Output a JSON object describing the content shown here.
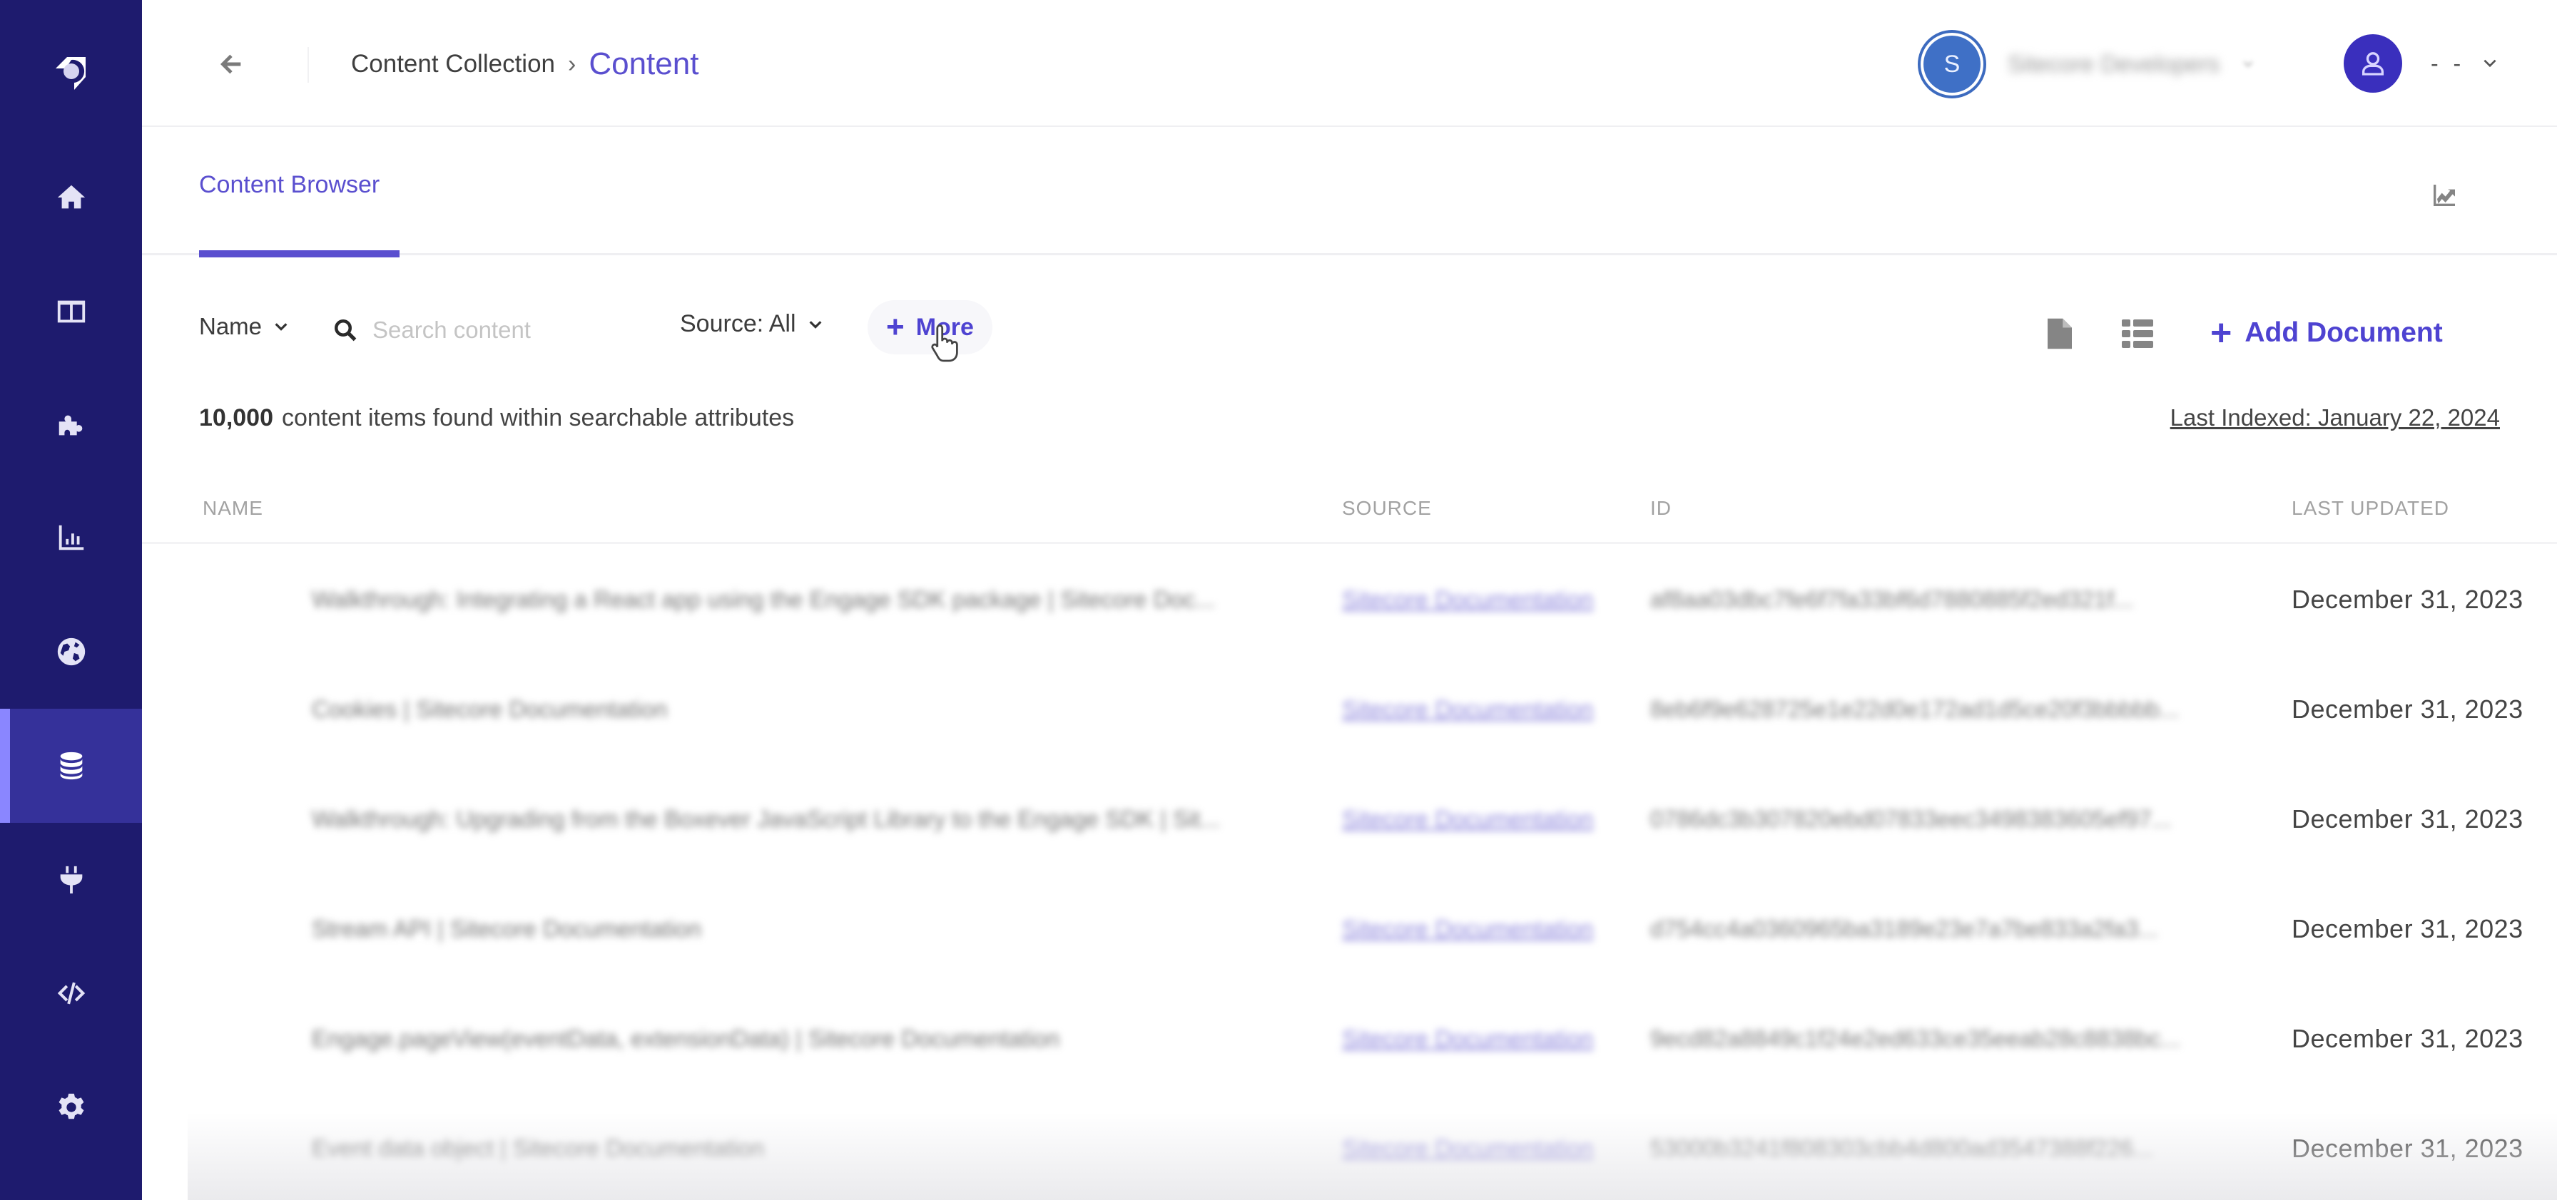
{
  "sidebar": {
    "logo": "sitecore-logo-icon",
    "items": [
      {
        "icon": "home-icon",
        "active": false
      },
      {
        "icon": "layout-columns-icon",
        "active": false
      },
      {
        "icon": "puzzle-icon",
        "active": false
      },
      {
        "icon": "bar-chart-icon",
        "active": false
      },
      {
        "icon": "globe-icon",
        "active": false
      },
      {
        "icon": "database-icon",
        "active": true
      },
      {
        "icon": "plug-icon",
        "active": false
      },
      {
        "icon": "code-icon",
        "active": false
      },
      {
        "icon": "gear-icon",
        "active": false
      }
    ]
  },
  "header": {
    "back_icon": "arrow-left-icon",
    "breadcrumb": {
      "parent": "Content Collection",
      "separator": "›",
      "current": "Content"
    },
    "tenant": {
      "initial": "S",
      "name": "Sitecore Developers"
    },
    "user": {
      "name": "- -"
    }
  },
  "tabs": [
    {
      "label": "Content Browser",
      "active": true
    }
  ],
  "toolbar": {
    "name_select": "Name",
    "search_placeholder": "Search content",
    "search_value": "",
    "source_select": "Source: All",
    "more_label": "More",
    "add_document_label": "Add Document"
  },
  "summary": {
    "count": "10,000",
    "count_text": "content items found within searchable attributes",
    "last_indexed": "Last Indexed: January 22, 2024"
  },
  "table": {
    "columns": [
      "Name",
      "Source",
      "ID",
      "Last Updated"
    ],
    "rows": [
      {
        "name": "Walkthrough: Integrating a React app using the Engage SDK package | Sitecore Doc...",
        "source": "Sitecore Documentation",
        "id": "af8aa03dbc7fe6f7fa33bf6d7880885f2ed321f...",
        "date": "December 31, 2023"
      },
      {
        "name": "Cookies | Sitecore Documentation",
        "source": "Sitecore Documentation",
        "id": "8eb6f9e628725e1e22d0e172ad1d5ce20f3bbbbb...",
        "date": "December 31, 2023"
      },
      {
        "name": "Walkthrough: Upgrading from the Boxever JavaScript Library to the Engage SDK | Sit...",
        "source": "Sitecore Documentation",
        "id": "0786dc3b307820ebd07833eec3498383605ef97...",
        "date": "December 31, 2023"
      },
      {
        "name": "Stream API | Sitecore Documentation",
        "source": "Sitecore Documentation",
        "id": "d754cc4a0360965ba3189e23e7a7be833a2fa3...",
        "date": "December 31, 2023"
      },
      {
        "name": "Engage.pageView(eventData, extensionData) | Sitecore Documentation",
        "source": "Sitecore Documentation",
        "id": "9ecd82a8849c1f24e2ed633ce35eeab28c8838bc...",
        "date": "December 31, 2023"
      },
      {
        "name": "Event data object | Sitecore Documentation",
        "source": "Sitecore Documentation",
        "id": "53000b3241f808303cbb4d800ad3547388f226...",
        "date": "December 31, 2023"
      }
    ]
  },
  "colors": {
    "sidebar_bg": "#1e1b6e",
    "sidebar_active": "#35319a",
    "accent": "#5a4fcf",
    "button_accent": "#4e43d1"
  }
}
